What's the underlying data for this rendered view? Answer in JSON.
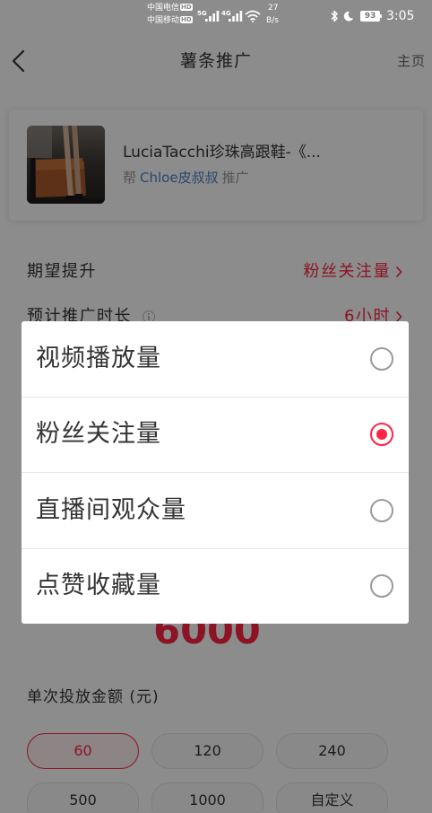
{
  "status_bar": {
    "carrier_top": "中国电信",
    "carrier_bottom": "中国移动",
    "hd_badge": "HD",
    "network_top": "5G",
    "network_bottom": "4G",
    "speed_value": "27",
    "speed_unit": "B/s",
    "battery_level": "93",
    "time": "3:05",
    "icons": [
      "signal-icon",
      "wifi-icon",
      "bluetooth-icon",
      "moon-icon",
      "battery-icon"
    ]
  },
  "header": {
    "back_icon": "chevron-left-icon",
    "title": "薯条推广",
    "home_label": "主页"
  },
  "post_card": {
    "title": "LuciaTacchi珍珠高跟鞋-《...",
    "promote_prefix": "帮",
    "promote_user": "Chloe皮叔叔",
    "promote_suffix": "推广"
  },
  "settings": {
    "goal": {
      "label": "期望提升",
      "value": "粉丝关注量",
      "icon": "chevron-right-icon"
    },
    "duration": {
      "label": "预计推广时长",
      "value": "6小时",
      "info_icon": "info-icon",
      "icon": "chevron-right-icon"
    }
  },
  "estimate": {
    "value": "6000"
  },
  "amount": {
    "label": "单次投放金额 (元)",
    "options": [
      {
        "label": "60",
        "selected": true
      },
      {
        "label": "120",
        "selected": false
      },
      {
        "label": "240",
        "selected": false
      },
      {
        "label": "500",
        "selected": false
      },
      {
        "label": "1000",
        "selected": false
      },
      {
        "label": "自定义",
        "selected": false
      }
    ]
  },
  "goal_picker": {
    "options": [
      {
        "label": "视频播放量",
        "checked": false
      },
      {
        "label": "粉丝关注量",
        "checked": true
      },
      {
        "label": "直播间观众量",
        "checked": false
      },
      {
        "label": "点赞收藏量",
        "checked": false
      }
    ]
  },
  "colors": {
    "accent": "#ff2442",
    "link": "#4a80c8",
    "text": "#333333",
    "muted": "#999999"
  }
}
